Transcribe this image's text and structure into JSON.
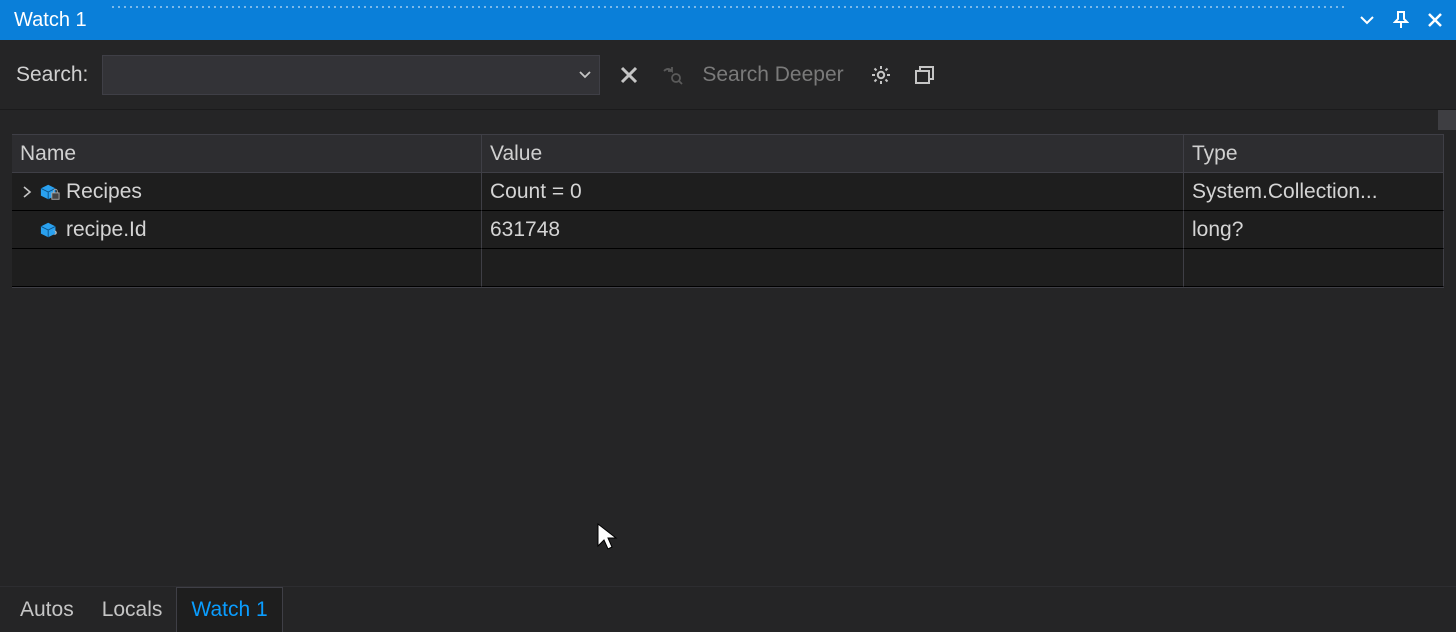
{
  "titlebar": {
    "title": "Watch 1"
  },
  "toolbar": {
    "search_label": "Search:",
    "search_value": "",
    "search_deeper_label": "Search Deeper"
  },
  "grid": {
    "headers": {
      "name": "Name",
      "value": "Value",
      "type": "Type"
    },
    "rows": [
      {
        "name": "Recipes",
        "value": "Count = 0",
        "type": "System.Collection...",
        "expandable": true,
        "icon": "object-locked"
      },
      {
        "name": "recipe.Id",
        "value": "631748",
        "type": "long?",
        "expandable": false,
        "icon": "object-member"
      }
    ]
  },
  "tabs": {
    "items": [
      {
        "label": "Autos",
        "active": false
      },
      {
        "label": "Locals",
        "active": false
      },
      {
        "label": "Watch 1",
        "active": true
      }
    ]
  }
}
